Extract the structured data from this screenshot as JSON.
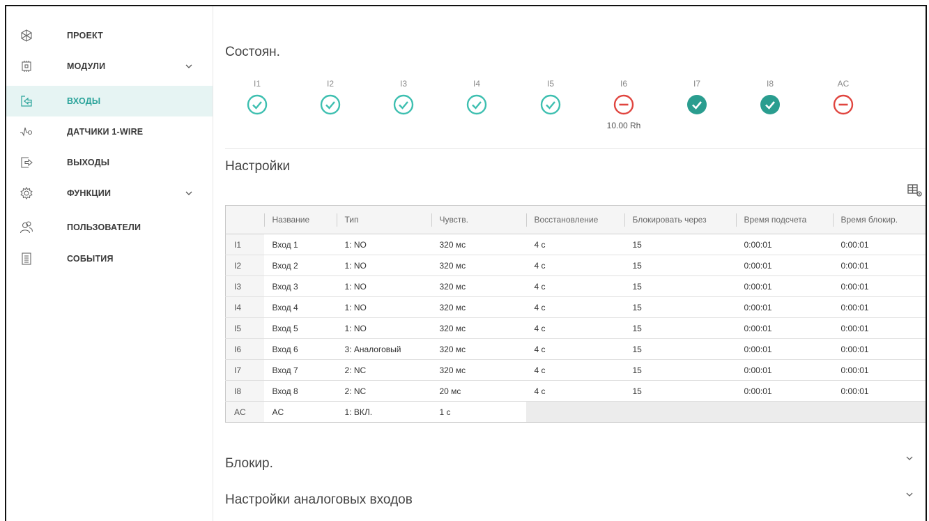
{
  "sidebar": {
    "items": [
      {
        "label": "ПРОЕКТ",
        "icon": "project-snowflake-icon",
        "expandable": false
      },
      {
        "label": "МОДУЛИ",
        "icon": "module-chip-icon",
        "expandable": true
      },
      {
        "label": "ВХОДЫ",
        "icon": "input-arrow-icon",
        "expandable": false,
        "active": true
      },
      {
        "label": "ДАТЧИКИ 1-WIRE",
        "icon": "sensor-wave-icon",
        "expandable": false
      },
      {
        "label": "ВЫХОДЫ",
        "icon": "output-arrow-icon",
        "expandable": false
      },
      {
        "label": "ФУНКЦИИ",
        "icon": "gear-icon",
        "expandable": true
      },
      {
        "label": "ПОЛЬЗОВАТЕЛИ",
        "icon": "users-icon",
        "expandable": false
      },
      {
        "label": "СОБЫТИЯ",
        "icon": "document-icon",
        "expandable": false
      }
    ]
  },
  "status": {
    "title": "Состоян.",
    "inputs": [
      {
        "name": "I1",
        "state": "ok-outline",
        "value": ""
      },
      {
        "name": "I2",
        "state": "ok-outline",
        "value": ""
      },
      {
        "name": "I3",
        "state": "ok-outline",
        "value": ""
      },
      {
        "name": "I4",
        "state": "ok-outline",
        "value": ""
      },
      {
        "name": "I5",
        "state": "ok-outline",
        "value": ""
      },
      {
        "name": "I6",
        "state": "blocked",
        "value": "10.00 Rh"
      },
      {
        "name": "I7",
        "state": "ok-filled",
        "value": ""
      },
      {
        "name": "I8",
        "state": "ok-filled",
        "value": ""
      },
      {
        "name": "AC",
        "state": "blocked",
        "value": ""
      }
    ]
  },
  "settings": {
    "title": "Настройки",
    "columns": [
      "",
      "Название",
      "Тип",
      "Чувств.",
      "Восстановление",
      "Блокировать через",
      "Время подсчета",
      "Время блокир."
    ],
    "rows": [
      [
        "I1",
        "Вход 1",
        "1: NO",
        "320 мс",
        "4 с",
        "15",
        "0:00:01",
        "0:00:01"
      ],
      [
        "I2",
        "Вход 2",
        "1: NO",
        "320 мс",
        "4 с",
        "15",
        "0:00:01",
        "0:00:01"
      ],
      [
        "I3",
        "Вход 3",
        "1: NO",
        "320 мс",
        "4 с",
        "15",
        "0:00:01",
        "0:00:01"
      ],
      [
        "I4",
        "Вход 4",
        "1: NO",
        "320 мс",
        "4 с",
        "15",
        "0:00:01",
        "0:00:01"
      ],
      [
        "I5",
        "Вход 5",
        "1: NO",
        "320 мс",
        "4 с",
        "15",
        "0:00:01",
        "0:00:01"
      ],
      [
        "I6",
        "Вход 6",
        "3: Аналоговый",
        "320 мс",
        "4 с",
        "15",
        "0:00:01",
        "0:00:01"
      ],
      [
        "I7",
        "Вход 7",
        "2: NC",
        "320 мс",
        "4 с",
        "15",
        "0:00:01",
        "0:00:01"
      ],
      [
        "I8",
        "Вход 8",
        "2: NC",
        "20 мс",
        "4 с",
        "15",
        "0:00:01",
        "0:00:01"
      ],
      [
        "AC",
        "AC",
        "1: ВКЛ.",
        "1 с",
        "",
        "",
        "",
        ""
      ]
    ]
  },
  "sections": [
    {
      "title": "Блокир."
    },
    {
      "title": "Настройки аналоговых входов"
    }
  ],
  "colors": {
    "accent": "#2aa39a",
    "ok": "#3dbfb0",
    "ok_filled": "#2a9d8f",
    "error": "#e0453f",
    "active_bg": "#e6f4f3"
  }
}
